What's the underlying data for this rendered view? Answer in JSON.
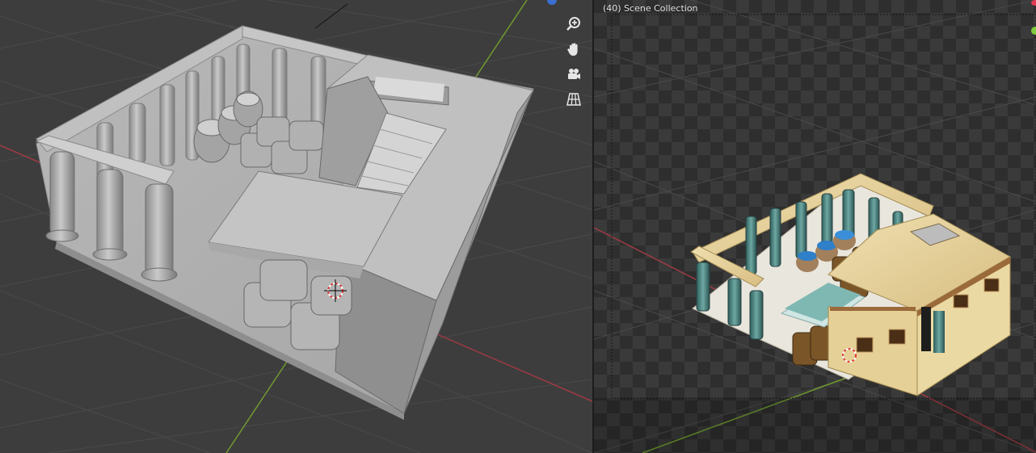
{
  "viewport_left": {
    "shading": "solid",
    "nav_tools": [
      {
        "name": "zoom",
        "icon": "magnifier-plus-icon"
      },
      {
        "name": "pan",
        "icon": "hand-icon"
      },
      {
        "name": "camera-view",
        "icon": "camera-icon"
      },
      {
        "name": "orthographic",
        "icon": "grid-perspective-icon"
      }
    ],
    "colors": {
      "grid": "#4a4a4a",
      "x_axis": "#9c3a44",
      "y_axis": "#6f9a2d",
      "background": "#3d3d3d",
      "model": "#b7b7b7"
    }
  },
  "viewport_right": {
    "camera_label": "(40) Scene Collection",
    "shading": "rendered",
    "colors": {
      "checker_a": "#3a3a3a",
      "checker_b": "#2e2e2e",
      "x_axis": "#9c3a44",
      "y_axis": "#6f9a2d",
      "sandstone": "#e4cf98",
      "column_teal": "#4f8e8c",
      "jar_blue": "#2f7fc9"
    }
  }
}
